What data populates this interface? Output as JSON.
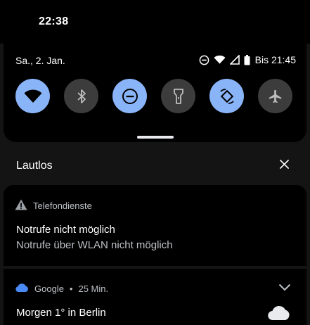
{
  "status_bar": {
    "time": "22:38"
  },
  "quick_settings": {
    "date": "Sa., 2. Jan.",
    "status_icons": [
      "do-not-disturb-icon",
      "wifi-icon",
      "signal-icon",
      "battery-icon"
    ],
    "battery_text": "Bis 21:45",
    "tiles": [
      {
        "name": "wifi",
        "icon": "wifi-icon",
        "active": true
      },
      {
        "name": "bluetooth",
        "icon": "bluetooth-icon",
        "active": false
      },
      {
        "name": "do-not-disturb",
        "icon": "do-not-disturb-icon",
        "active": true
      },
      {
        "name": "flashlight",
        "icon": "flashlight-icon",
        "active": false
      },
      {
        "name": "auto-rotate",
        "icon": "auto-rotate-icon",
        "active": true
      },
      {
        "name": "airplane-mode",
        "icon": "airplane-icon",
        "active": false
      }
    ]
  },
  "silent_section": {
    "title": "Lautlos",
    "close_icon": "close-icon"
  },
  "notifications": [
    {
      "app": "Telefondienste",
      "app_icon": "warning-icon",
      "title": "Notrufe nicht möglich",
      "text": "Notrufe über WLAN nicht möglich"
    },
    {
      "app": "Google",
      "app_icon": "cloud-icon",
      "separator": "•",
      "time": "25 Min.",
      "title": "Morgen 1° in Berlin",
      "expand_icon": "chevron-down-icon",
      "large_icon": "weather-cloud-icon"
    }
  ],
  "colors": {
    "tile_on": "#8ab4f8",
    "tile_off": "#3c3c3c",
    "panel": "#000000",
    "background": "#141414"
  }
}
